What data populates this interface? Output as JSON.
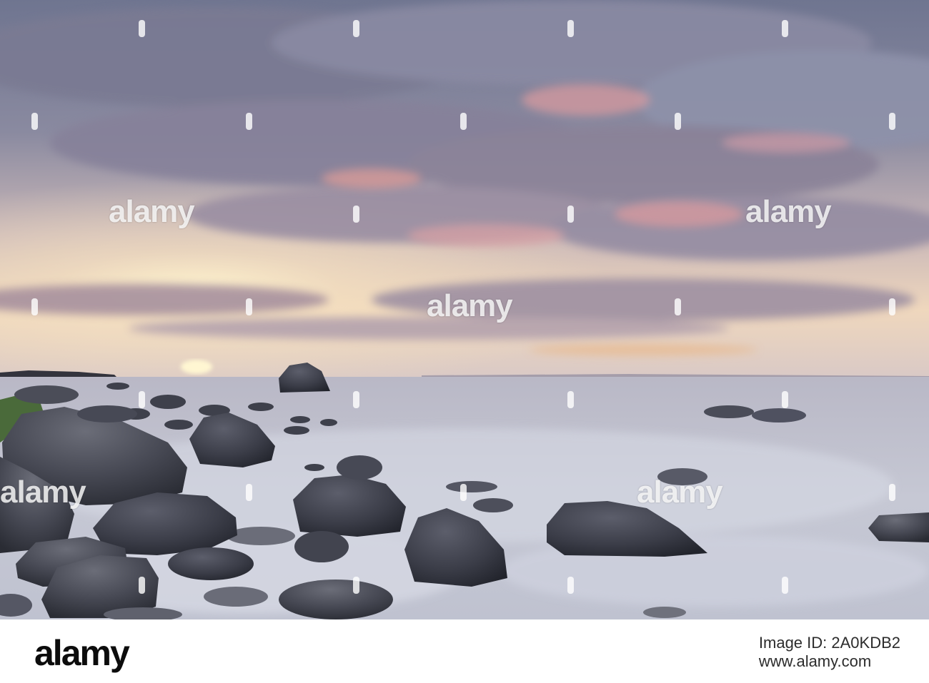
{
  "watermark": {
    "brand": "alamy"
  },
  "footer": {
    "logo": "alamy",
    "image_id_line": "Image ID: 2A0KDB2",
    "site": "www.alamy.com"
  },
  "scene": {
    "colors": {
      "sky_top": "#7d8299",
      "sky_glow": "#f6e3bf",
      "cloud_pink": "#d99a9e",
      "sea": "#c3c6d2",
      "rock": "#3b3d47"
    }
  }
}
